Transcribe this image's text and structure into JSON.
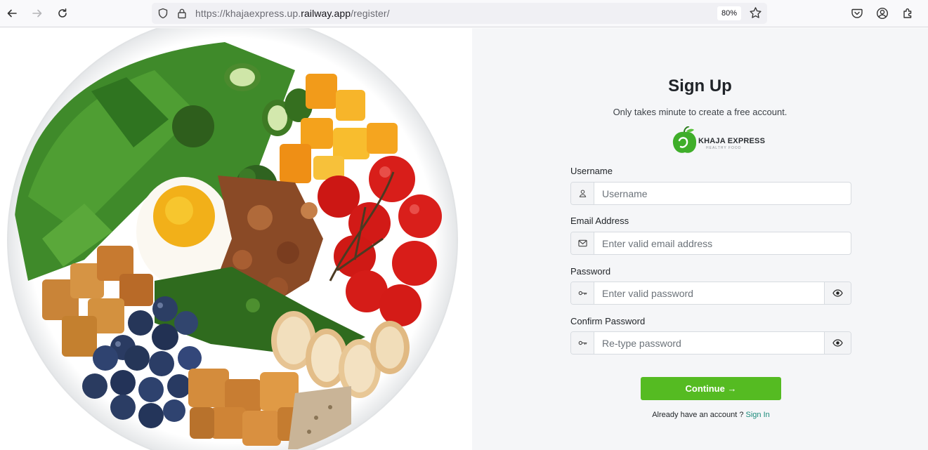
{
  "browser": {
    "url_prefix": "https://khajaexpress.up.",
    "url_host": "railway.app",
    "url_path": "/register/",
    "zoom": "80%"
  },
  "signup": {
    "title": "Sign Up",
    "subtitle": "Only takes minute to create a free account.",
    "brand_name": "KHAJA EXPRESS",
    "brand_tagline": "HEALTHY FOOD",
    "username_label": "Username",
    "username_placeholder": "Username",
    "email_label": "Email Address",
    "email_placeholder": "Enter valid email address",
    "password_label": "Password",
    "password_placeholder": "Enter valid password",
    "confirm_label": "Confirm Password",
    "confirm_placeholder": "Re-type password",
    "continue_label": "Continue →",
    "account_prompt": "Already have an account ? ",
    "signin_link": "Sign In"
  },
  "colors": {
    "accent_green": "#55bb22",
    "link_teal": "#1a8a7a",
    "panel_bg": "#f5f6f8"
  },
  "icons": [
    "back-arrow-icon",
    "forward-arrow-icon",
    "reload-icon",
    "shield-icon",
    "lock-icon",
    "star-icon",
    "pocket-icon",
    "account-icon",
    "extensions-icon",
    "user-icon",
    "envelope-icon",
    "key-icon",
    "eye-icon"
  ]
}
